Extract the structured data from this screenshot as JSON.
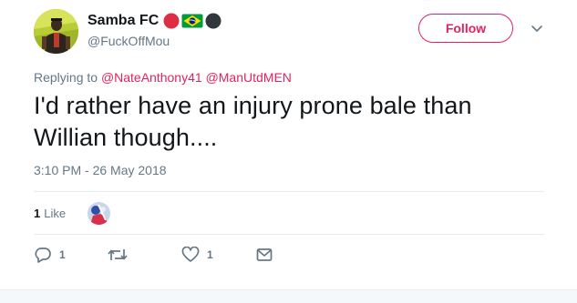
{
  "tweet": {
    "author": {
      "display_name": "Samba FC",
      "handle": "@FuckOffMou",
      "name_emojis": [
        "red-circle-emoji",
        "brazil-flag-emoji",
        "black-circle-emoji"
      ]
    },
    "follow_label": "Follow",
    "replying_prefix": "Replying to",
    "replying_to": [
      "@NateAnthony41",
      "@ManUtdMEN"
    ],
    "text": "I'd rather have an injury prone bale than Willian though....",
    "timestamp": "3:10 PM - 26 May 2018",
    "likes": {
      "count": "1",
      "label": "Like"
    },
    "actions": {
      "reply_count": "1",
      "retweet_count": "",
      "like_count": "1",
      "icons": [
        "reply-icon",
        "retweet-icon",
        "heart-icon",
        "message-icon"
      ]
    }
  },
  "colors": {
    "accent": "#e0245e",
    "secondary_text": "#657786",
    "primary_text": "#14171a",
    "divider": "#e6ecf0"
  }
}
